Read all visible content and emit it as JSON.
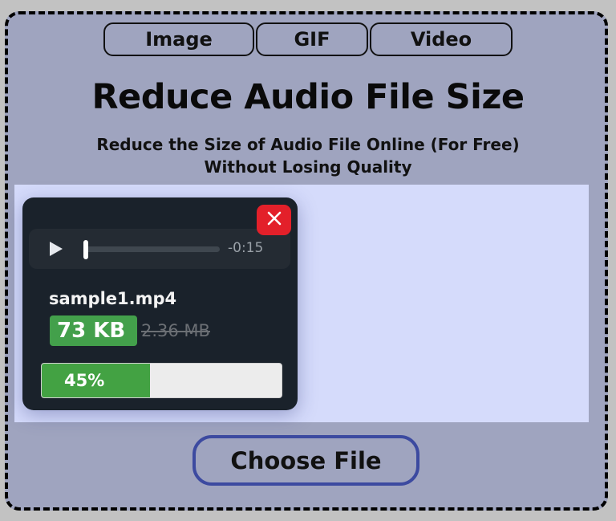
{
  "tabs": [
    {
      "label": "Image"
    },
    {
      "label": "GIF"
    },
    {
      "label": "Video"
    }
  ],
  "header": {
    "title": "Reduce Audio File Size",
    "subtitle_line1": "Reduce the Size of Audio File Online (For Free)",
    "subtitle_line2": "Without Losing Quality"
  },
  "file_card": {
    "close_icon": "close-icon",
    "player": {
      "play_icon": "play-icon",
      "time_remaining": "-0:15",
      "playback_position": 0
    },
    "filename": "sample1.mp4",
    "compressed_size": "73 KB",
    "original_size": "2.36 MB",
    "progress": {
      "label": "45%",
      "value": 0.45
    }
  },
  "actions": {
    "choose_file_label": "Choose File"
  },
  "colors": {
    "accent_green": "#43a04b",
    "close_red": "#e3202a",
    "button_border": "#3c4aa0",
    "card_bg": "#1a222b",
    "dropzone_bg": "#d5dbfb",
    "frame_bg": "#9fa4bf"
  }
}
